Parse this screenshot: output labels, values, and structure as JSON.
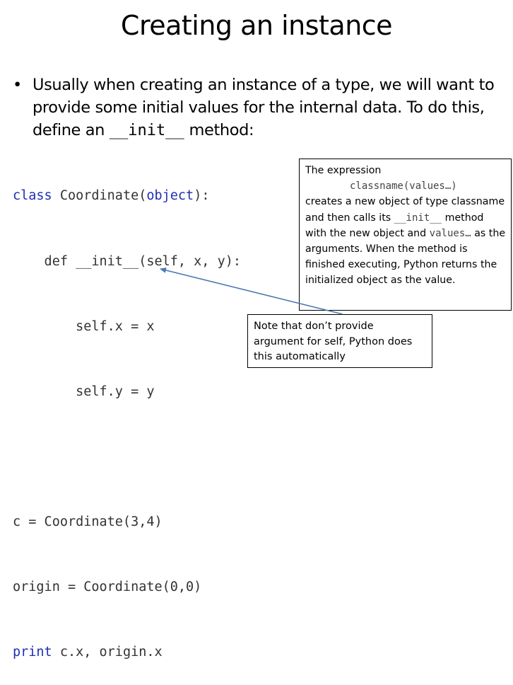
{
  "title": "Creating an instance",
  "bullet": {
    "marker": "•",
    "text_before": "Usually when creating an instance of a type, we will want to provide some initial values for the internal data.  To do this, define an ",
    "code": "__init__",
    "text_after": " method:"
  },
  "code": {
    "line1_kw": "class",
    "line1_mid": " Coordinate(",
    "line1_obj": "object",
    "line1_end": "):",
    "line2": "    def __init__(self, x, y):",
    "line3": "        self.x = x",
    "line4": "        self.y = y",
    "line6": "c = Coordinate(3,4)",
    "line7": "origin = Coordinate(0,0)",
    "line8_kw": "print",
    "line8_rest": " c.x, origin.x"
  },
  "callout_expression": {
    "line1": "The expression",
    "line2_code": "classname(values…)",
    "text1": "creates a new object of type classname and then calls its ",
    "code1": "__init__",
    "text2": " method with the new object and ",
    "code2": "values…",
    "text3": "  as the arguments.  When the method is finished executing, Python returns the initialized object as the value."
  },
  "callout_self": {
    "text": "Note that don’t provide argument for self, Python does this automatically"
  },
  "colors": {
    "keyword": "#1f2fb4",
    "code_text": "#333333",
    "arrow": "#4a78b5"
  }
}
